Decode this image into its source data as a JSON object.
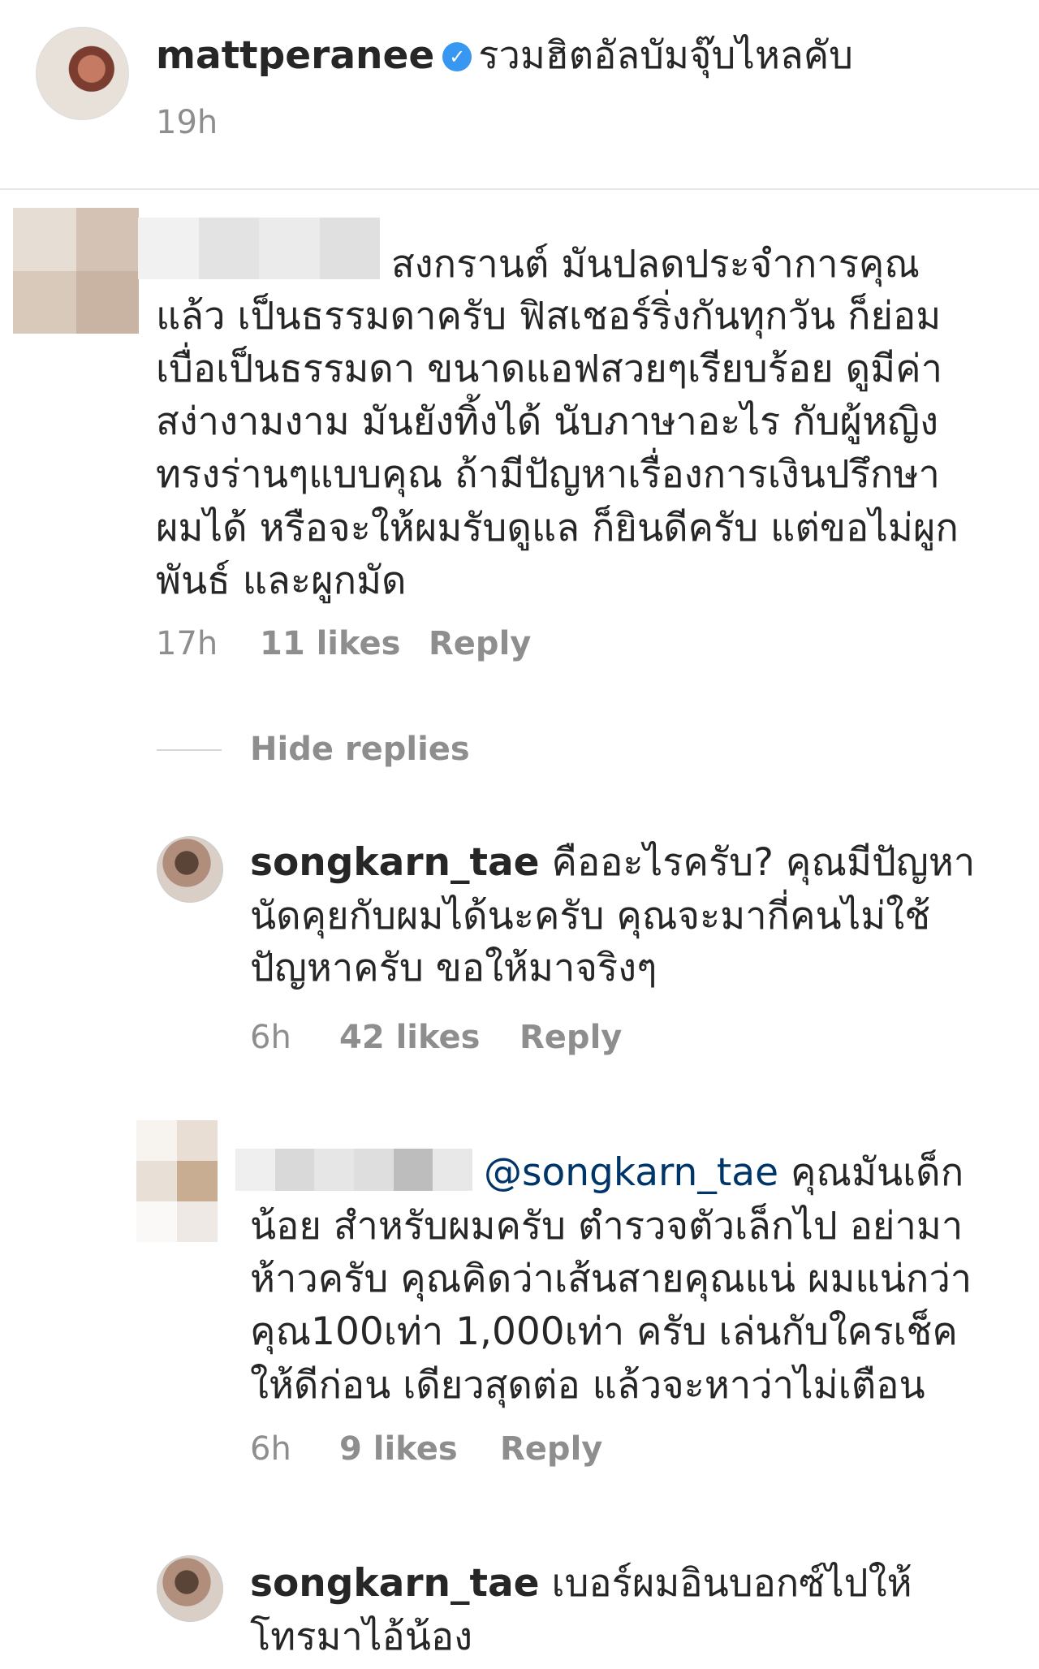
{
  "post": {
    "username": "mattperanee",
    "verified_icon": "verified-badge-icon",
    "caption": "รวมฮิตอัลบัมจุ๊บไหลคับ",
    "time": "19h"
  },
  "comments": [
    {
      "text_lines": [
        "สงกรานต์ มันปลดประจำการคุณ",
        "แล้ว เป็นธรรมดาครับ ฟิสเชอร์ริ่งกันทุกวัน ก็ย่อม",
        "เบื่อเป็นธรรมดา ขนาดแอฟสวยๆเรียบร้อย ดูมีค่า",
        "สง่างามงาม มันยังทิ้งได้ นับภาษาอะไร กับผู้หญิง",
        "ทรงร่านๆแบบคุณ ถ้ามีปัญหาเรื่องการเงินปรึกษา",
        "ผมได้ หรือจะให้ผมรับดูแล ก็ยินดีครับ แต่ขอไม่ผูก",
        "พันธ์ และผูกมัด"
      ],
      "time": "17h",
      "likes": "11 likes",
      "reply_label": "Reply",
      "hide_replies": "Hide replies"
    }
  ],
  "replies": [
    {
      "username": "songkarn_tae",
      "text_lines": [
        "คืออะไรครับ? คุณมีปัญหา",
        "นัดคุยกับผมได้นะครับ คุณจะมากี่คนไม่ใช้",
        "ปัญหาครับ ขอให้มาจริงๆ"
      ],
      "time": "6h",
      "likes": "42 likes",
      "reply_label": "Reply"
    },
    {
      "mention": "@songkarn_tae",
      "text_lines": [
        "คุณมันเด็ก",
        "น้อย สำหรับผมครับ ตำรวจตัวเล็กไป อย่ามา",
        "ห้าวครับ คุณคิดว่าเส้นสายคุณแน่ ผมแน่กว่า",
        "คุณ100เท่า 1,000เท่า ครับ เล่นกับใครเช็ค",
        "ให้ดีก่อน เดียวสุดต่อ แล้วจะหาว่าไม่เตือน"
      ],
      "time": "6h",
      "likes": "9 likes",
      "reply_label": "Reply"
    },
    {
      "username": "songkarn_tae",
      "text_lines": [
        "เบอร์ผมอินบอกซ์ไปให้",
        "โทรมาไอ้น้อง"
      ]
    }
  ],
  "colors": {
    "text": "#262626",
    "meta": "#8e8e8e",
    "mention": "#003569",
    "verified": "#3897f0"
  }
}
